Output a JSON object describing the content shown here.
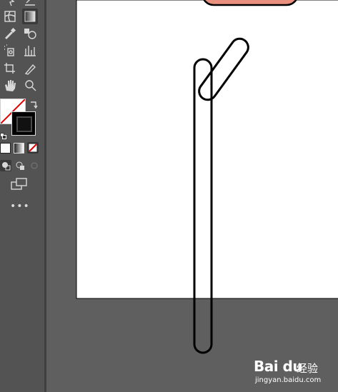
{
  "app": {
    "workspace_bg": "#5f5f5f",
    "toolbar_bg": "#535353",
    "artboard_color": "#ffffff",
    "accent_shape_fill": "#e9907f"
  },
  "toolbar": {
    "tools": [
      {
        "name": "direct-selection-tool",
        "icon": "direct-select-icon"
      },
      {
        "name": "pen-tool",
        "icon": "pen-icon"
      },
      {
        "name": "mesh-tool",
        "icon": "mesh-icon"
      },
      {
        "name": "gradient-tool",
        "icon": "gradient-icon"
      },
      {
        "name": "eyedropper-tool",
        "icon": "eyedropper-icon"
      },
      {
        "name": "shape-builder-tool",
        "icon": "shape-builder-icon"
      },
      {
        "name": "symbol-sprayer-tool",
        "icon": "symbol-sprayer-icon"
      },
      {
        "name": "graph-tool",
        "icon": "column-graph-icon"
      },
      {
        "name": "artboard-tool",
        "icon": "artboard-icon"
      },
      {
        "name": "slice-tool",
        "icon": "slice-icon"
      },
      {
        "name": "hand-tool",
        "icon": "hand-icon"
      },
      {
        "name": "zoom-tool",
        "icon": "magnifier-icon"
      }
    ],
    "fill_color": "none",
    "stroke_color": "#000000",
    "more_tools_label": "•••"
  },
  "watermark": {
    "brand": "Bai du",
    "brand_suffix": "经验",
    "domain": "jingyan.baidu.com"
  }
}
